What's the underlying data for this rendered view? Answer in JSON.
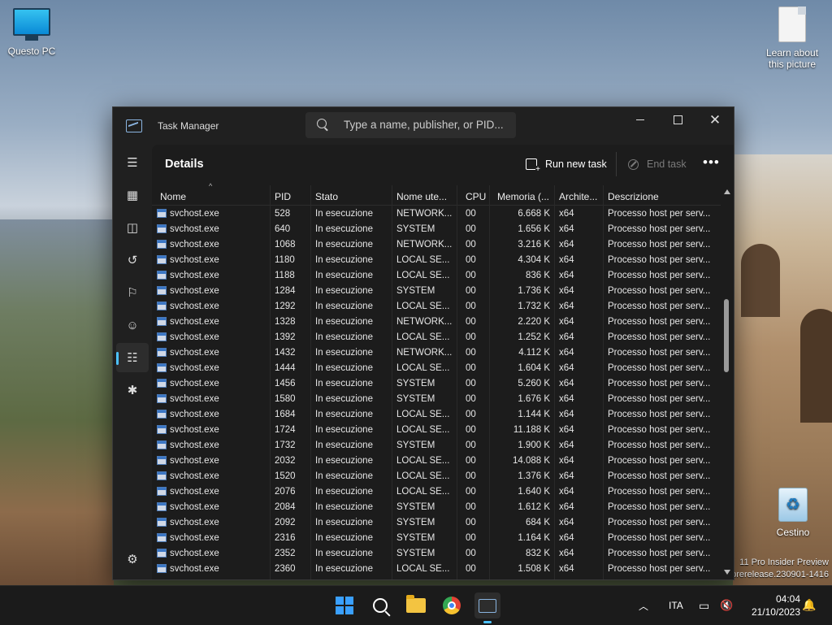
{
  "desktop": {
    "icons": [
      {
        "label": "Questo PC"
      },
      {
        "label": "Learn about this picture"
      },
      {
        "label": "Cestino"
      }
    ],
    "watermark": [
      "11 Pro Insider Preview",
      "prerelease.230901-1416"
    ]
  },
  "window": {
    "title": "Task Manager",
    "search_placeholder": "Type a name, publisher, or PID...",
    "page_title": "Details",
    "run_new_task_label": "Run new task",
    "end_task_label": "End task",
    "more_label": "•••",
    "nav_items": [
      "menu-icon",
      "processes-icon",
      "performance-icon",
      "app-history-icon",
      "startup-apps-icon",
      "users-icon",
      "details-icon",
      "services-icon",
      "settings-icon"
    ],
    "columns": [
      "Nome",
      "PID",
      "Stato",
      "Nome ute...",
      "CPU",
      "Memoria (...",
      "Archite...",
      "Descrizione"
    ],
    "rows": [
      [
        "svchost.exe",
        "528",
        "In esecuzione",
        "NETWORK...",
        "00",
        "6.668 K",
        "x64",
        "Processo host per serv..."
      ],
      [
        "svchost.exe",
        "640",
        "In esecuzione",
        "SYSTEM",
        "00",
        "1.656 K",
        "x64",
        "Processo host per serv..."
      ],
      [
        "svchost.exe",
        "1068",
        "In esecuzione",
        "NETWORK...",
        "00",
        "3.216 K",
        "x64",
        "Processo host per serv..."
      ],
      [
        "svchost.exe",
        "1180",
        "In esecuzione",
        "LOCAL SE...",
        "00",
        "4.304 K",
        "x64",
        "Processo host per serv..."
      ],
      [
        "svchost.exe",
        "1188",
        "In esecuzione",
        "LOCAL SE...",
        "00",
        "836 K",
        "x64",
        "Processo host per serv..."
      ],
      [
        "svchost.exe",
        "1284",
        "In esecuzione",
        "SYSTEM",
        "00",
        "1.736 K",
        "x64",
        "Processo host per serv..."
      ],
      [
        "svchost.exe",
        "1292",
        "In esecuzione",
        "LOCAL SE...",
        "00",
        "1.732 K",
        "x64",
        "Processo host per serv..."
      ],
      [
        "svchost.exe",
        "1328",
        "In esecuzione",
        "NETWORK...",
        "00",
        "2.220 K",
        "x64",
        "Processo host per serv..."
      ],
      [
        "svchost.exe",
        "1392",
        "In esecuzione",
        "LOCAL SE...",
        "00",
        "1.252 K",
        "x64",
        "Processo host per serv..."
      ],
      [
        "svchost.exe",
        "1432",
        "In esecuzione",
        "NETWORK...",
        "00",
        "4.112 K",
        "x64",
        "Processo host per serv..."
      ],
      [
        "svchost.exe",
        "1444",
        "In esecuzione",
        "LOCAL SE...",
        "00",
        "1.604 K",
        "x64",
        "Processo host per serv..."
      ],
      [
        "svchost.exe",
        "1456",
        "In esecuzione",
        "SYSTEM",
        "00",
        "5.260 K",
        "x64",
        "Processo host per serv..."
      ],
      [
        "svchost.exe",
        "1580",
        "In esecuzione",
        "SYSTEM",
        "00",
        "1.676 K",
        "x64",
        "Processo host per serv..."
      ],
      [
        "svchost.exe",
        "1684",
        "In esecuzione",
        "LOCAL SE...",
        "00",
        "1.144 K",
        "x64",
        "Processo host per serv..."
      ],
      [
        "svchost.exe",
        "1724",
        "In esecuzione",
        "LOCAL SE...",
        "00",
        "11.188 K",
        "x64",
        "Processo host per serv..."
      ],
      [
        "svchost.exe",
        "1732",
        "In esecuzione",
        "SYSTEM",
        "00",
        "1.900 K",
        "x64",
        "Processo host per serv..."
      ],
      [
        "svchost.exe",
        "2032",
        "In esecuzione",
        "LOCAL SE...",
        "00",
        "14.088 K",
        "x64",
        "Processo host per serv..."
      ],
      [
        "svchost.exe",
        "1520",
        "In esecuzione",
        "LOCAL SE...",
        "00",
        "1.376 K",
        "x64",
        "Processo host per serv..."
      ],
      [
        "svchost.exe",
        "2076",
        "In esecuzione",
        "LOCAL SE...",
        "00",
        "1.640 K",
        "x64",
        "Processo host per serv..."
      ],
      [
        "svchost.exe",
        "2084",
        "In esecuzione",
        "SYSTEM",
        "00",
        "1.612 K",
        "x64",
        "Processo host per serv..."
      ],
      [
        "svchost.exe",
        "2092",
        "In esecuzione",
        "SYSTEM",
        "00",
        "684 K",
        "x64",
        "Processo host per serv..."
      ],
      [
        "svchost.exe",
        "2316",
        "In esecuzione",
        "SYSTEM",
        "00",
        "1.164 K",
        "x64",
        "Processo host per serv..."
      ],
      [
        "svchost.exe",
        "2352",
        "In esecuzione",
        "SYSTEM",
        "00",
        "832 K",
        "x64",
        "Processo host per serv..."
      ],
      [
        "svchost.exe",
        "2360",
        "In esecuzione",
        "LOCAL SE...",
        "00",
        "1.508 K",
        "x64",
        "Processo host per serv..."
      ]
    ]
  },
  "taskbar": {
    "language": "ITA",
    "time": "04:04",
    "date": "21/10/2023"
  },
  "colors": {
    "accent": "#4cc2ff",
    "window_bg": "#202020",
    "content_bg": "#1c1c1c"
  }
}
